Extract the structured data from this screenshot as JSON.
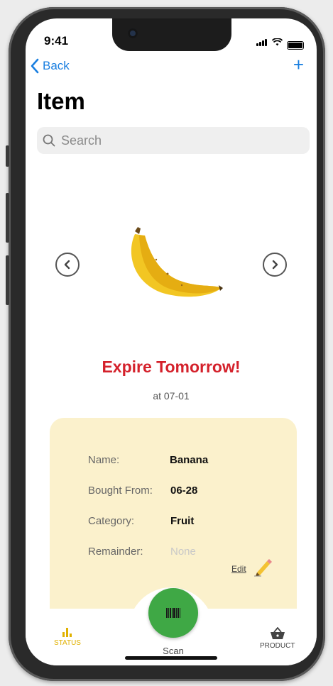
{
  "status_bar": {
    "time": "9:41"
  },
  "nav": {
    "back_label": "Back",
    "add_label": "+"
  },
  "page": {
    "title": "Item"
  },
  "search": {
    "placeholder": "Search"
  },
  "item": {
    "image_icon": "banana-image",
    "expire_text": "Expire Tomorrow!",
    "expire_date": "at 07-01",
    "fields": [
      {
        "label": "Name:",
        "value": "Banana"
      },
      {
        "label": "Bought From:",
        "value": "06-28"
      },
      {
        "label": "Category:",
        "value": "Fruit"
      },
      {
        "label": "Remainder:",
        "value": "None"
      }
    ],
    "edit_label": "Edit"
  },
  "tabbar": {
    "status_label": "STATUS",
    "scan_label": "Scan",
    "product_label": "PRODUCT"
  },
  "colors": {
    "accent_blue": "#1a7fe0",
    "expire_red": "#d4212b",
    "card_bg": "#fbf1cc",
    "scan_green": "#3fa845",
    "status_yellow": "#e0b100"
  }
}
